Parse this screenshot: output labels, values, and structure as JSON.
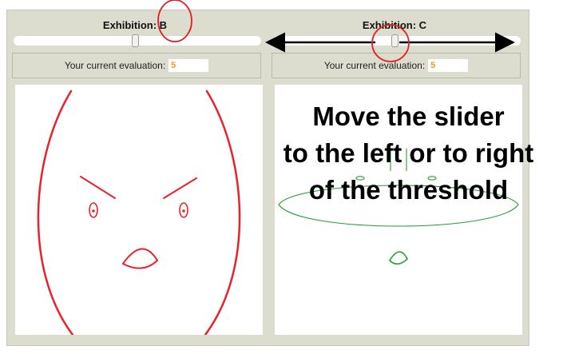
{
  "panels": {
    "left": {
      "title": "Exhibition: B",
      "slider_value": 0.5,
      "eval_label": "Your current evaluation:",
      "eval_value": "5",
      "face_color": "#e8222a"
    },
    "right": {
      "title": "Exhibition: C",
      "slider_value": 0.5,
      "eval_label": "Your current evaluation:",
      "eval_value": "5",
      "face_color": "#2a9a3a"
    }
  },
  "annotation": {
    "text": "Move the slider\nto the left or to right\nof the threshold",
    "highlight_color": "#e02020",
    "arrow_color": "#000000"
  }
}
